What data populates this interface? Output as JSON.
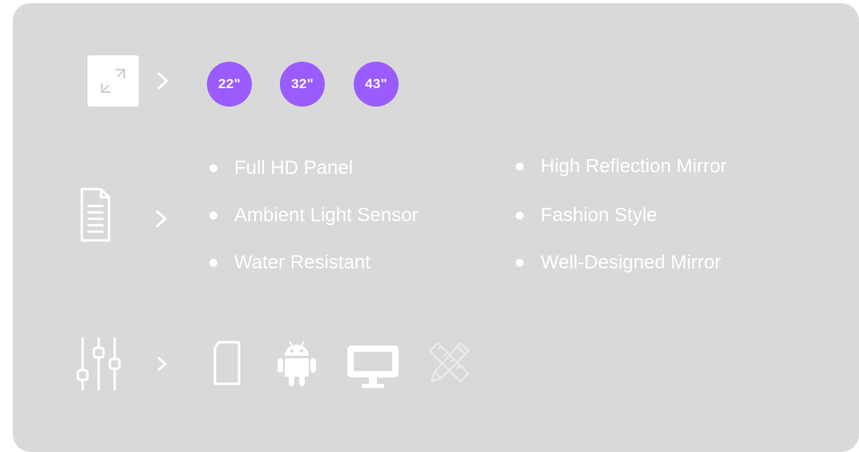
{
  "sizes": {
    "icon": "expand-arrows-icon",
    "badges": [
      "22\"",
      "32\"",
      "43\""
    ],
    "badge_color": "#9b5cff"
  },
  "features": {
    "icon": "document-icon",
    "left": [
      "Full HD Panel",
      "Ambient Light Sensor",
      "Water Resistant"
    ],
    "right": [
      "High Reflection Mirror",
      "Fashion Style",
      "Well-Designed Mirror"
    ]
  },
  "specs": {
    "icon": "sliders-icon",
    "items": [
      "sd-card-icon",
      "android-icon",
      "monitor-icon",
      "ruler-pencil-icon"
    ]
  },
  "colors": {
    "card_background": "#d9d9d9",
    "foreground": "#ffffff"
  }
}
